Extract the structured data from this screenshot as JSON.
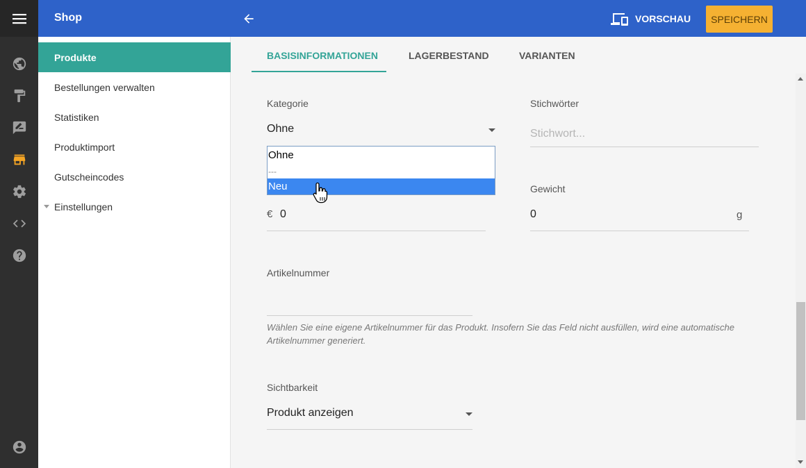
{
  "topbar": {
    "menu_icon": "menu-icon",
    "title": "Shop",
    "back_icon": "arrow-left-icon",
    "preview_icon": "devices-icon",
    "preview_label": "VORSCHAU",
    "save_label": "SPEICHERN"
  },
  "rail": {
    "icons": [
      "globe-icon",
      "paint-roller-icon",
      "edit-note-icon",
      "store-icon",
      "gear-icon",
      "code-icon",
      "help-icon",
      "account-icon"
    ],
    "active": "store-icon"
  },
  "sidebar": {
    "items": [
      {
        "label": "Produkte",
        "active": true
      },
      {
        "label": "Bestellungen verwalten"
      },
      {
        "label": "Statistiken"
      },
      {
        "label": "Produktimport"
      },
      {
        "label": "Gutscheincodes"
      },
      {
        "label": "Einstellungen",
        "expandable": true
      }
    ]
  },
  "tabs": [
    {
      "label": "BASISINFORMATIONEN",
      "active": true
    },
    {
      "label": "LAGERBESTAND"
    },
    {
      "label": "VARIANTEN"
    }
  ],
  "form": {
    "category": {
      "label": "Kategorie",
      "value": "Ohne",
      "options": [
        "Ohne",
        "---",
        "Neu"
      ],
      "highlighted": "Neu"
    },
    "keywords": {
      "label": "Stichwörter",
      "placeholder": "Stichwort..."
    },
    "price": {
      "currency": "€",
      "value": "0"
    },
    "weight": {
      "label": "Gewicht",
      "value": "0",
      "unit": "g"
    },
    "sku": {
      "label": "Artikelnummer",
      "value": "",
      "hint": "Wählen Sie eine eigene Artikelnummer für das Produkt. Insofern Sie das Feld nicht ausfüllen, wird eine automatische Artikelnummer generiert."
    },
    "visibility": {
      "label": "Sichtbarkeit",
      "value": "Produkt anzeigen"
    }
  },
  "colors": {
    "topbar": "#2e62c9",
    "accent_teal": "#33a497",
    "save_button": "#f5b132",
    "highlight": "#3b87f0"
  }
}
